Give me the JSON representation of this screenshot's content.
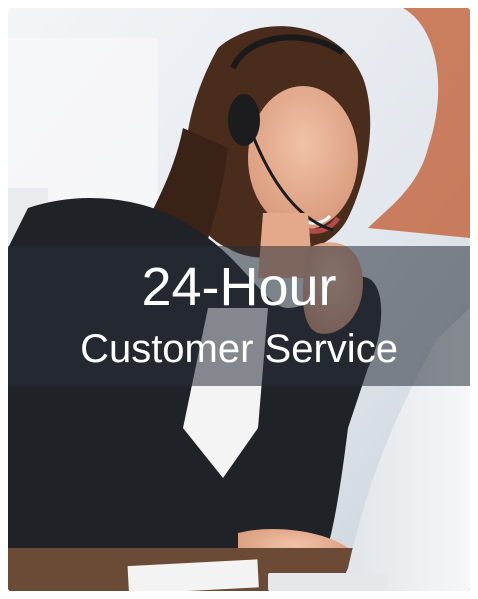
{
  "banner": {
    "headline": "24-Hour",
    "subheadline": "Customer Service"
  },
  "colors": {
    "overlay": "#28303a",
    "text": "#ffffff",
    "jacket": "#1f2227",
    "hair": "#4a2c1c"
  }
}
